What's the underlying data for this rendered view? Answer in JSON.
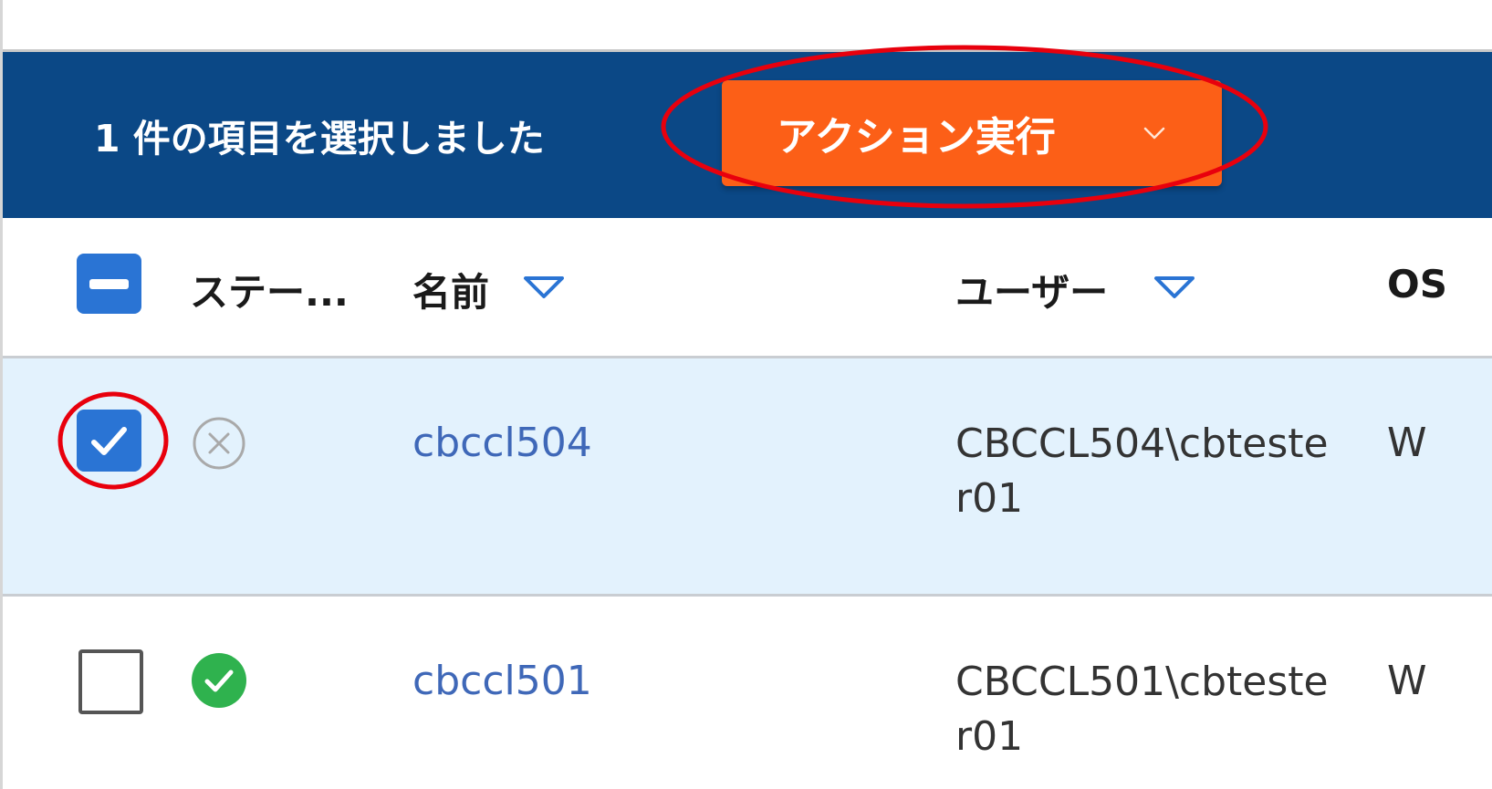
{
  "selection_bar": {
    "text": "1 件の項目を選択しました",
    "action_button_label": "アクション実行",
    "action_chevron_icon": "chevron-down-icon",
    "background": "#0b4886",
    "button_color": "#fc5f17"
  },
  "table": {
    "headers": {
      "status": "ステー...",
      "name": "名前",
      "user": "ユーザー",
      "os": "OS"
    },
    "rows": [
      {
        "selected": true,
        "status_icon": "error-circle-icon",
        "name": "cbccl504",
        "user": "CBCCL504\\cbtester01",
        "os": "W"
      },
      {
        "selected": false,
        "status_icon": "success-check-icon",
        "name": "cbccl501",
        "user": "CBCCL501\\cbtester01",
        "os": "W"
      }
    ]
  },
  "annotations": {
    "color": "#e8000d"
  }
}
